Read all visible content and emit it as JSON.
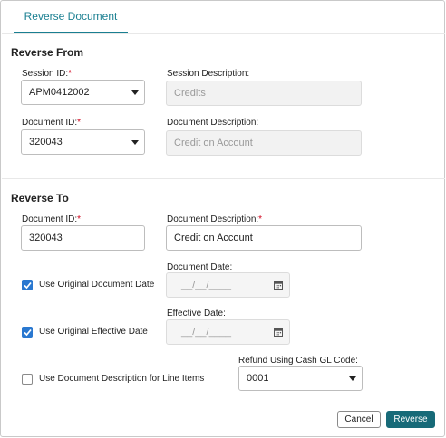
{
  "tabs": {
    "active": "Reverse Document"
  },
  "reverse_from": {
    "title": "Reverse From",
    "session_id": {
      "label": "Session ID:",
      "required_mark": "*",
      "value": "APM0412002"
    },
    "session_description": {
      "label": "Session Description:",
      "value": "Credits"
    },
    "document_id": {
      "label": "Document ID:",
      "required_mark": "*",
      "value": "320043"
    },
    "document_description": {
      "label": "Document Description:",
      "value": "Credit on Account"
    }
  },
  "reverse_to": {
    "title": "Reverse To",
    "document_id": {
      "label": "Document ID:",
      "required_mark": "*",
      "value": "320043"
    },
    "document_description": {
      "label": "Document Description:",
      "required_mark": "*",
      "value": "Credit on Account"
    },
    "use_original_document_date": {
      "label": "Use Original Document Date",
      "checked": true
    },
    "document_date": {
      "label": "Document Date:",
      "placeholder": "__/__/____"
    },
    "use_original_effective_date": {
      "label": "Use Original Effective Date",
      "checked": true
    },
    "effective_date": {
      "label": "Effective Date:",
      "placeholder": "__/__/____"
    },
    "use_doc_desc_for_line_items": {
      "label": "Use Document Description for Line Items",
      "checked": false
    },
    "refund_cash_gl_code": {
      "label": "Refund Using Cash GL Code:",
      "value": "0001"
    }
  },
  "actions": {
    "cancel_label": "Cancel",
    "reverse_label": "Reverse"
  },
  "colors": {
    "accent": "#1a7f91",
    "primary_button": "#176a78",
    "checkbox": "#2a78d0",
    "required": "#d0021b"
  }
}
